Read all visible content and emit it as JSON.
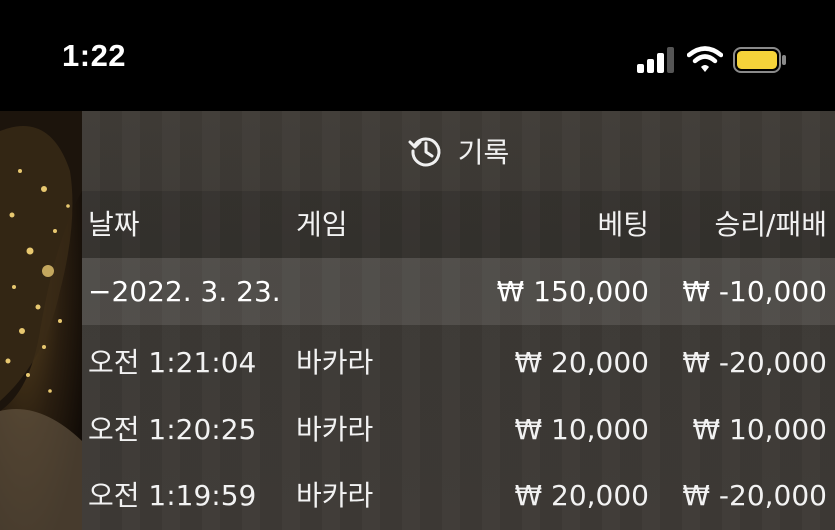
{
  "status_bar": {
    "time": "1:22",
    "icons": [
      "cellular-signal-icon",
      "wifi-icon",
      "battery-icon"
    ],
    "battery_color": "#f5d33a"
  },
  "panel": {
    "title": "기록",
    "icon": "history-icon",
    "columns": {
      "date": "날짜",
      "game": "게임",
      "bet": "베팅",
      "result": "승리/패배"
    },
    "date_group": {
      "date": "−2022. 3. 23.",
      "bet": "₩ 150,000",
      "result": "₩ -10,000"
    },
    "rows": [
      {
        "time": "오전 1:21:04",
        "game": "바카라",
        "bet": "₩ 20,000",
        "result": "₩ -20,000"
      },
      {
        "time": "오전 1:20:25",
        "game": "바카라",
        "bet": "₩ 10,000",
        "result": "₩ 10,000"
      },
      {
        "time": "오전 1:19:59",
        "game": "바카라",
        "bet": "₩ 20,000",
        "result": "₩ -20,000"
      }
    ]
  }
}
